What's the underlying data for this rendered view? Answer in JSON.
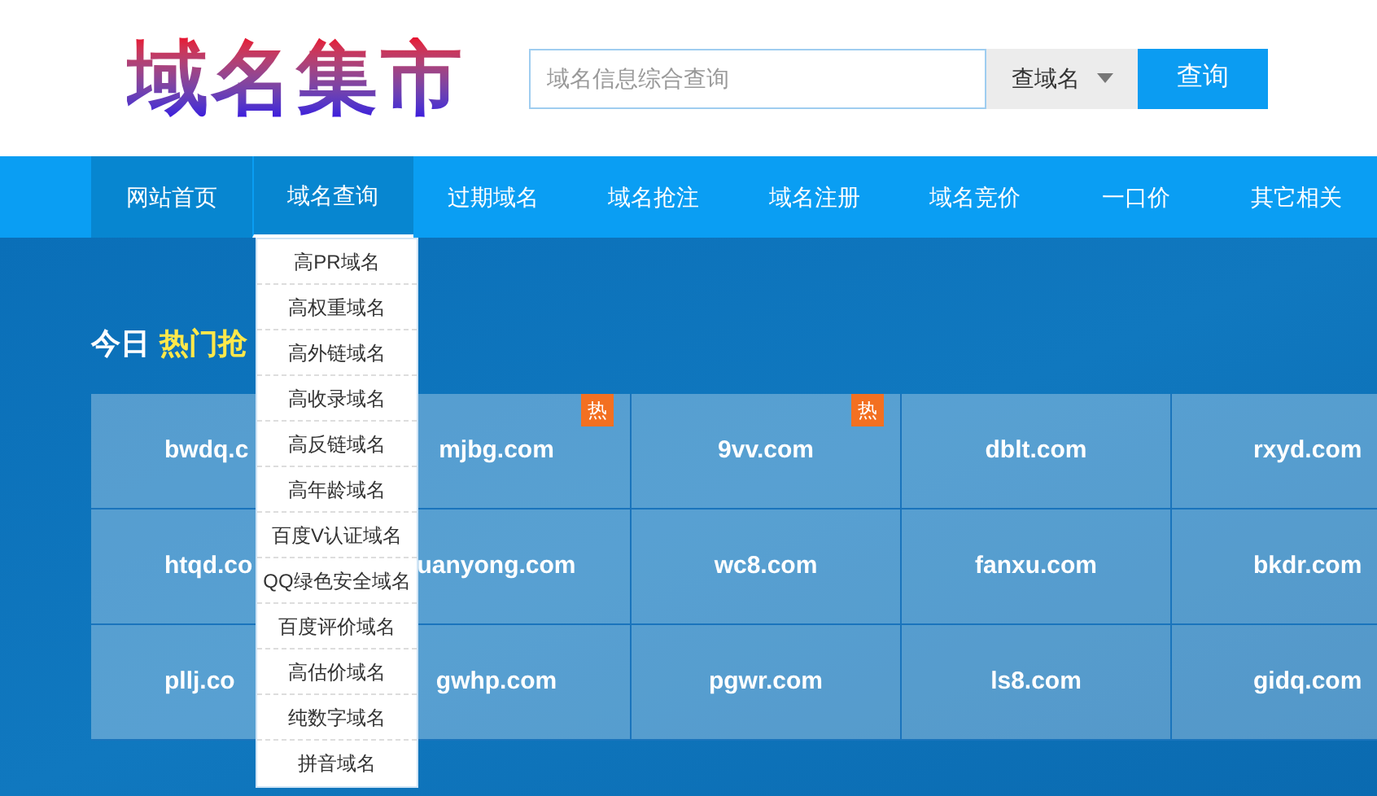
{
  "logo": {
    "text": "域名集市"
  },
  "search": {
    "placeholder": "域名信息综合查询",
    "select": "查域名",
    "button": "查询"
  },
  "nav": [
    {
      "label": "网站首页",
      "selected": true,
      "expanded": false
    },
    {
      "label": "域名查询",
      "selected": true,
      "expanded": true
    },
    {
      "label": "过期域名",
      "selected": false,
      "expanded": false
    },
    {
      "label": "域名抢注",
      "selected": false,
      "expanded": false
    },
    {
      "label": "域名注册",
      "selected": false,
      "expanded": false
    },
    {
      "label": "域名竞价",
      "selected": false,
      "expanded": false
    },
    {
      "label": "一口价",
      "selected": false,
      "expanded": false
    },
    {
      "label": "其它相关",
      "selected": false,
      "expanded": false
    }
  ],
  "dropdown": {
    "items": [
      "高PR域名",
      "高权重域名",
      "高外链域名",
      "高收录域名",
      "高反链域名",
      "高年龄域名",
      "百度V认证域名",
      "QQ绿色安全域名",
      "百度评价域名",
      "高估价域名",
      "纯数字域名",
      "拼音域名"
    ]
  },
  "heading": {
    "prefix": "今日",
    "highlight": "热门抢"
  },
  "domains": [
    [
      {
        "name": "bwdq.c"
      },
      {
        "name": "mjbg.com",
        "badge": "热"
      },
      {
        "name": "9vv.com",
        "badge": "热"
      },
      {
        "name": "dblt.com"
      },
      {
        "name": "rxyd.com"
      }
    ],
    [
      {
        "name": "htqd.co"
      },
      {
        "name": "uanyong.com"
      },
      {
        "name": "wc8.com"
      },
      {
        "name": "fanxu.com"
      },
      {
        "name": "bkdr.com"
      }
    ],
    [
      {
        "name": "pllj.co"
      },
      {
        "name": "gwhp.com"
      },
      {
        "name": "pgwr.com"
      },
      {
        "name": "ls8.com"
      },
      {
        "name": "gidq.com"
      }
    ]
  ]
}
